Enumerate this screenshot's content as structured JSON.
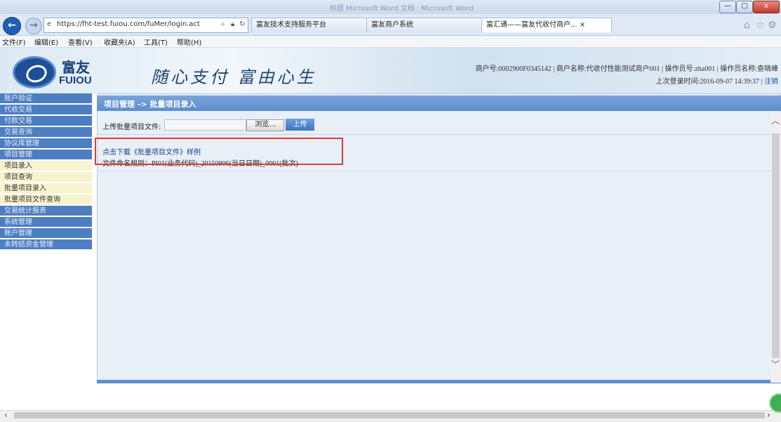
{
  "browser": {
    "ghost_title": "标题 Microsoft Word 文档 · Microsoft Word",
    "url": "https://fht-test.fuiou.com/fuMer/login.act",
    "tabs": [
      {
        "label": "富友技术支持服务平台"
      },
      {
        "label": "富友商户系统"
      },
      {
        "label": "富汇通——富友代收付商户..."
      }
    ],
    "window_buttons": {
      "minimize": "—",
      "maximize": "▢",
      "close": "x"
    }
  },
  "menubar": [
    "文件(F)",
    "编辑(E)",
    "查看(V)",
    "收藏夹(A)",
    "工具(T)",
    "帮助(H)"
  ],
  "header": {
    "logo_zh": "富友",
    "logo_en": "FUIOU",
    "slogan": "随心支付 富由心生",
    "merchant_line": "商户号:0002900F0345142 | 商户名称:代收付性能测试商户001 | 操作员号:zha001 | 操作员名称:查晓峰",
    "login_line": "上次登录时间:2016-09-07 14:39:37 |",
    "logout": "注销"
  },
  "sidebar": {
    "items": [
      {
        "label": "账户验证",
        "style": "blue"
      },
      {
        "label": "代收交易",
        "style": "blue"
      },
      {
        "label": "付款交易",
        "style": "blue"
      },
      {
        "label": "交易查询",
        "style": "blue"
      },
      {
        "label": "协议库管理",
        "style": "blue"
      },
      {
        "label": "项目管理",
        "style": "blue"
      },
      {
        "label": "项目录入",
        "style": "light"
      },
      {
        "label": "项目查询",
        "style": "light"
      },
      {
        "label": "批量项目录入",
        "style": "light"
      },
      {
        "label": "批量项目文件查询",
        "style": "light"
      },
      {
        "label": "交易统计报表",
        "style": "blue"
      },
      {
        "label": "系统管理",
        "style": "blue"
      },
      {
        "label": "账户管理",
        "style": "blue"
      },
      {
        "label": "未转结资金管理",
        "style": "blue"
      }
    ]
  },
  "main": {
    "title": "项目管理 -> 批量项目录入",
    "upload_label": "上传批量项目文件:",
    "browse_label": "浏览...",
    "upload_button": "上传",
    "download_link": "点击下载《批量项目文件》样例",
    "naming_rule": "文件命名规则：PI01(业务代码)_20150906(当日日期)_0001(批次)"
  },
  "colors": {
    "accent": "#4e7ec2",
    "highlight_box": "#e03a3a",
    "submenu_bg": "#f8f3cf"
  }
}
